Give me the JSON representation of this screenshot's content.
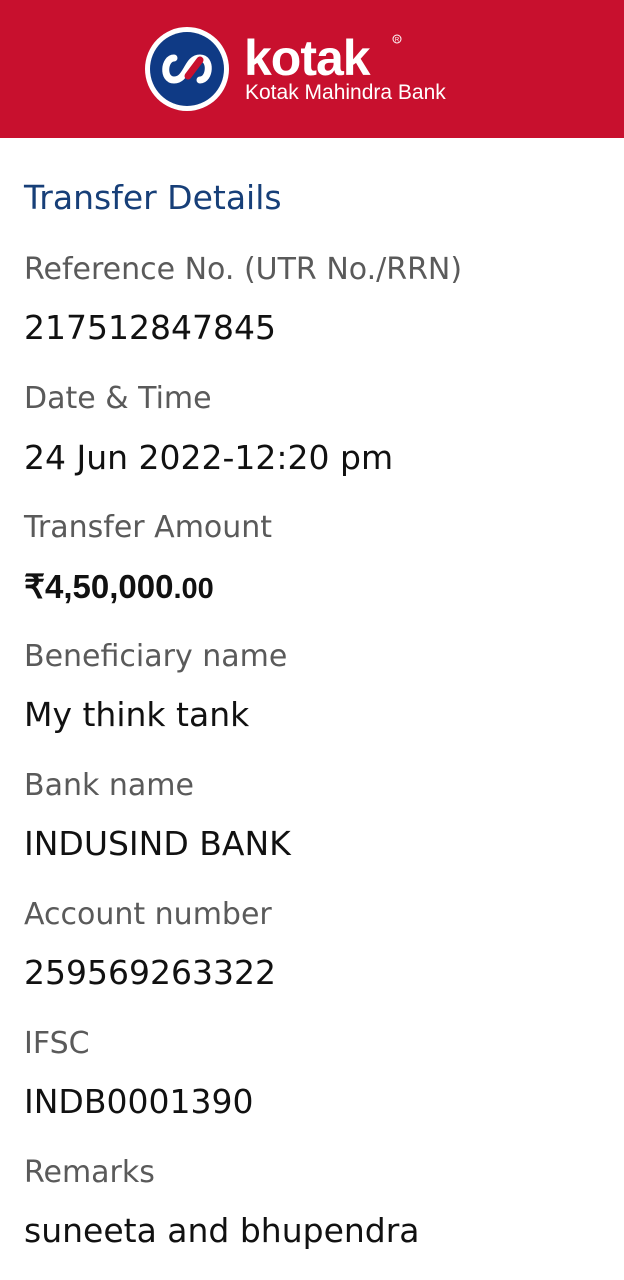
{
  "brand": {
    "name": "kotak",
    "subtitle": "Kotak Mahindra Bank",
    "color": "#c8102e",
    "logo_circle_color": "#0f3a85"
  },
  "section_title": "Transfer Details",
  "fields": {
    "reference": {
      "label": "Reference No. (UTR No./RRN)",
      "value": "217512847845"
    },
    "datetime": {
      "label": "Date & Time",
      "value": "24 Jun 2022-12:20 pm"
    },
    "amount": {
      "label": "Transfer Amount",
      "value_main": "₹4,50,000",
      "value_decimal": ".00"
    },
    "beneficiary": {
      "label": "Beneficiary name",
      "value": "My think tank"
    },
    "bank": {
      "label": "Bank name",
      "value": "INDUSIND BANK"
    },
    "account": {
      "label": "Account number",
      "value": "259569263322"
    },
    "ifsc": {
      "label": "IFSC",
      "value": "INDB0001390"
    },
    "remarks": {
      "label": "Remarks",
      "value": "suneeta and bhupendra"
    }
  }
}
